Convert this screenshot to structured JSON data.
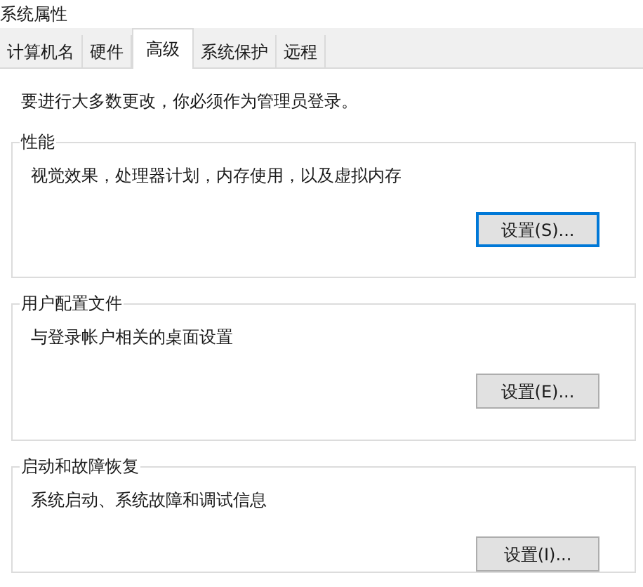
{
  "window": {
    "title": "系统属性"
  },
  "tabs": [
    {
      "label": "计算机名",
      "selected": false
    },
    {
      "label": "硬件",
      "selected": false
    },
    {
      "label": "高级",
      "selected": true
    },
    {
      "label": "系统保护",
      "selected": false
    },
    {
      "label": "远程",
      "selected": false
    }
  ],
  "notice": "要进行大多数更改，你必须作为管理员登录。",
  "groups": [
    {
      "title": "性能",
      "description": "视觉效果，处理器计划，内存使用，以及虚拟内存",
      "button": {
        "label": "设置(S)...",
        "default": true
      }
    },
    {
      "title": "用户配置文件",
      "description": "与登录帐户相关的桌面设置",
      "button": {
        "label": "设置(E)...",
        "default": false
      }
    },
    {
      "title": "启动和故障恢复",
      "description": "系统启动、系统故障和调试信息",
      "button": {
        "label": "设置(I)...",
        "default": false
      }
    }
  ]
}
